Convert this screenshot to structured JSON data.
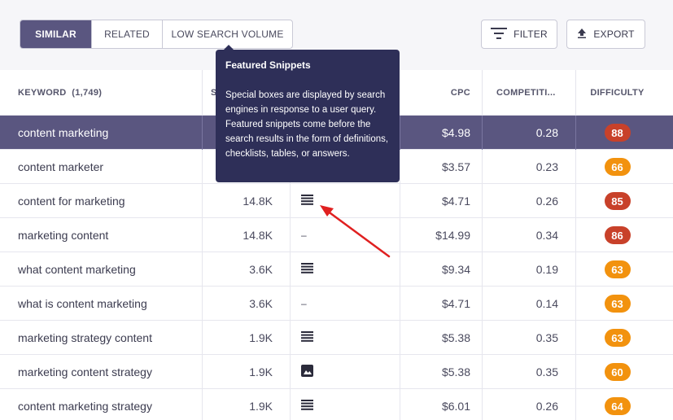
{
  "tabs": [
    {
      "label": "SIMILAR",
      "active": true
    },
    {
      "label": "RELATED",
      "active": false
    },
    {
      "label": "LOW SEARCH VOLUME",
      "active": false
    }
  ],
  "actions": {
    "filter_label": "FILTER",
    "filter_icon": "filter-lines-icon",
    "export_label": "EXPORT",
    "export_icon": "upload-arrow-icon"
  },
  "table": {
    "columns": {
      "keyword": "KEYWORD",
      "keyword_count": "(1,749)",
      "volume_partial": "S",
      "cpc": "CPC",
      "competition": "COMPETITI...",
      "difficulty": "DIFFICULTY"
    },
    "rows": [
      {
        "keyword": "content marketing",
        "volume": "",
        "serp": "",
        "cpc": "$4.98",
        "competition": "0.28",
        "difficulty": "88",
        "diff_color": "#c8412a",
        "selected": true
      },
      {
        "keyword": "content marketer",
        "volume": "",
        "serp": "",
        "cpc": "$3.57",
        "competition": "0.23",
        "difficulty": "66",
        "diff_color": "#f2920e",
        "selected": false
      },
      {
        "keyword": "content for marketing",
        "volume": "14.8K",
        "serp": "list-icon",
        "cpc": "$4.71",
        "competition": "0.26",
        "difficulty": "85",
        "diff_color": "#c8412a",
        "selected": false
      },
      {
        "keyword": "marketing content",
        "volume": "14.8K",
        "serp": "–",
        "cpc": "$14.99",
        "competition": "0.34",
        "difficulty": "86",
        "diff_color": "#c8412a",
        "selected": false
      },
      {
        "keyword": "what content marketing",
        "volume": "3.6K",
        "serp": "list-icon",
        "cpc": "$9.34",
        "competition": "0.19",
        "difficulty": "63",
        "diff_color": "#f2920e",
        "selected": false
      },
      {
        "keyword": "what is content marketing",
        "volume": "3.6K",
        "serp": "–",
        "cpc": "$4.71",
        "competition": "0.14",
        "difficulty": "63",
        "diff_color": "#f2920e",
        "selected": false
      },
      {
        "keyword": "marketing strategy content",
        "volume": "1.9K",
        "serp": "list-icon",
        "cpc": "$5.38",
        "competition": "0.35",
        "difficulty": "63",
        "diff_color": "#f2920e",
        "selected": false
      },
      {
        "keyword": "marketing content strategy",
        "volume": "1.9K",
        "serp": "image-icon",
        "cpc": "$5.38",
        "competition": "0.35",
        "difficulty": "60",
        "diff_color": "#f2920e",
        "selected": false
      },
      {
        "keyword": "content marketing strategy",
        "volume": "1.9K",
        "serp": "list-icon",
        "cpc": "$6.01",
        "competition": "0.26",
        "difficulty": "64",
        "diff_color": "#f2920e",
        "selected": false
      }
    ]
  },
  "tooltip": {
    "title": "Featured Snippets",
    "body": "Special boxes are displayed by search engines in response to a user query. Featured snippets come before the search results in the form of definitions, checklists, tables, or answers."
  },
  "colors": {
    "accent": "#5a5680",
    "tooltip_bg": "#2e2f58",
    "diff_red": "#c8412a",
    "diff_orange": "#f2920e",
    "arrow": "#e02020"
  }
}
